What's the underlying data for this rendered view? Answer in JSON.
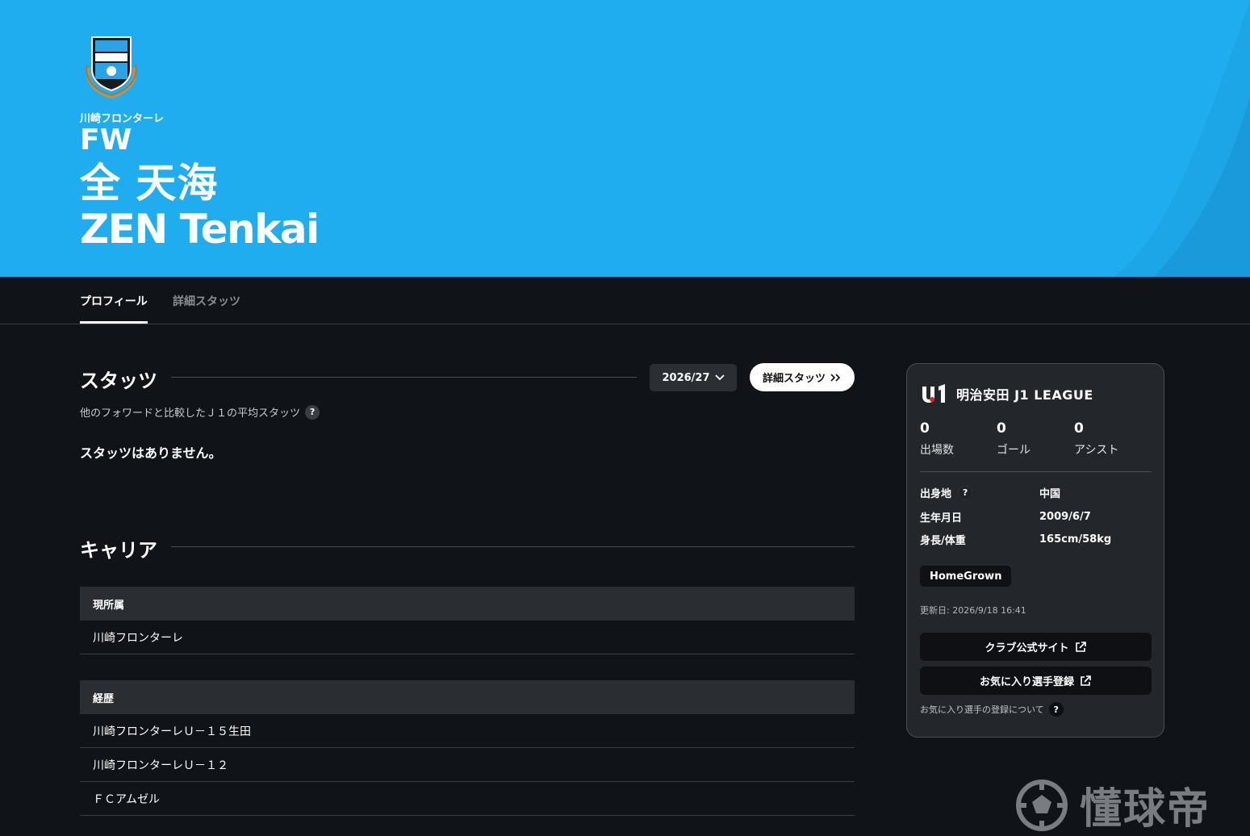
{
  "hero": {
    "club_name": "川崎フロンターレ",
    "position": "FW",
    "name_jp": "全 天海",
    "name_en": "ZEN Tenkai",
    "background_color": "#20adf0"
  },
  "tabs": [
    {
      "label": "プロフィール",
      "active": true
    },
    {
      "label": "詳細スタッツ",
      "active": false
    }
  ],
  "stats": {
    "title": "スタッツ",
    "season": "2026/27",
    "detail_button": "詳細スタッツ",
    "subtitle": "他のフォワードと比較したＪ１の平均スタッツ",
    "help_icon": "?",
    "empty_message": "スタッツはありません。"
  },
  "career": {
    "title": "キャリア",
    "current": {
      "header": "現所属",
      "rows": [
        "川崎フロンターレ"
      ]
    },
    "history": {
      "header": "経歴",
      "rows": [
        "川崎フロンターレＵ－１５生田",
        "川崎フロンターレＵ－１２",
        "ＦＣアムゼル"
      ]
    }
  },
  "card": {
    "league_name": "明治安田 J1 LEAGUE",
    "stats": [
      {
        "value": "0",
        "label": "出場数"
      },
      {
        "value": "0",
        "label": "ゴール"
      },
      {
        "value": "0",
        "label": "アシスト"
      }
    ],
    "info": [
      {
        "label": "出身地",
        "value": "中国",
        "help": "?"
      },
      {
        "label": "生年月日",
        "value": "2009/6/7"
      },
      {
        "label": "身長/体重",
        "value": "165cm/58kg"
      }
    ],
    "badge": "HomeGrown",
    "updated": "更新日: 2026/9/18 16:41",
    "club_site_button": "クラブ公式サイト",
    "favorite_button": "お気に入り選手登録",
    "favorite_about": "お気に入り選手の登録について",
    "help_icon": "?"
  },
  "watermark": {
    "text": "懂球帝"
  }
}
